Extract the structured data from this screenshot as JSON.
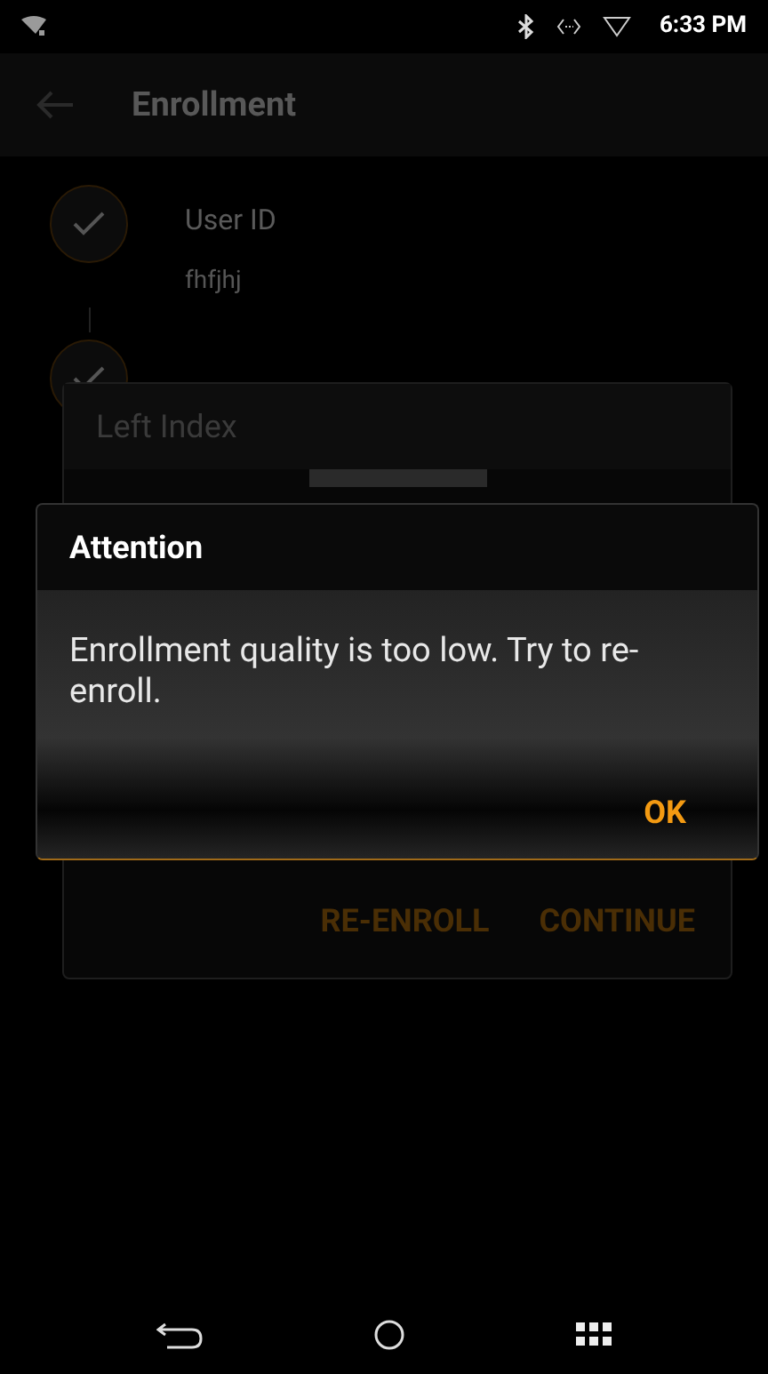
{
  "status_bar": {
    "time": "6:33 PM"
  },
  "app_bar": {
    "title": "Enrollment"
  },
  "steps": [
    {
      "label": "User ID",
      "value": "fhfjhj",
      "done": true
    },
    {
      "done": true
    }
  ],
  "background_dialog": {
    "title": "Left Index",
    "buttons": [
      "RE-ENROLL",
      "CONTINUE"
    ]
  },
  "alert": {
    "title": "Attention",
    "message": "Enrollment quality is too low. Try to re-enroll.",
    "buttons": [
      "OK"
    ]
  }
}
